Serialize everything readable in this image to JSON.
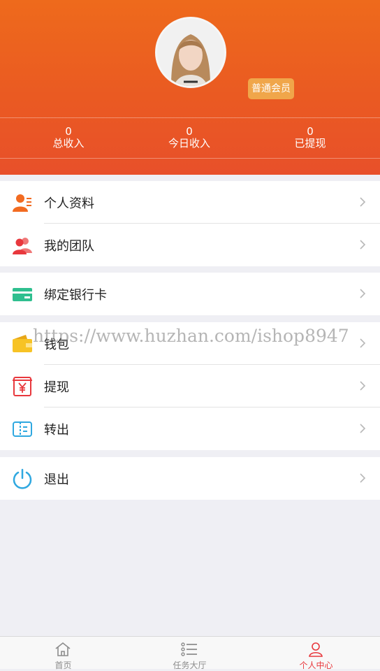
{
  "profile": {
    "member_level": "普通会员"
  },
  "stats": [
    {
      "value": "0",
      "label": "总收入"
    },
    {
      "value": "0",
      "label": "今日收入"
    },
    {
      "value": "0",
      "label": "已提现"
    }
  ],
  "menu": {
    "profile": "个人资料",
    "team": "我的团队",
    "bind_card": "绑定银行卡",
    "wallet": "钱包",
    "withdraw": "提现",
    "transfer": "转出",
    "logout": "退出"
  },
  "watermark": "https://www.huzhan.com/ishop8947",
  "tabs": [
    {
      "label": "首页"
    },
    {
      "label": "任务大厅"
    },
    {
      "label": "个人中心"
    }
  ],
  "colors": {
    "header": "#ea5a22",
    "badge": "#f0a64a",
    "active_tab": "#e8383d"
  }
}
